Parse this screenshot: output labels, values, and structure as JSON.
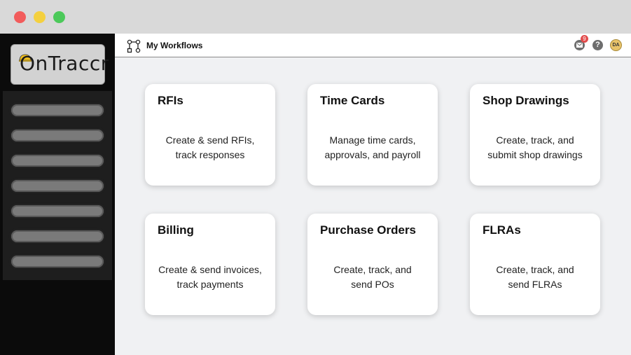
{
  "window": {
    "controls": [
      "close",
      "minimize",
      "maximize"
    ]
  },
  "sidebar": {
    "logo_text": "OnTraccr",
    "nav_item_count": 7
  },
  "header": {
    "title": "My Workflows",
    "notifications_badge": "9",
    "help_label": "?",
    "avatar_initials": "DA"
  },
  "cards": [
    {
      "title": "RFIs",
      "description": "Create & send RFIs,\ntrack responses"
    },
    {
      "title": "Time Cards",
      "description": "Manage time cards,\napprovals, and payroll"
    },
    {
      "title": "Shop Drawings",
      "description": "Create, track, and\nsubmit shop drawings"
    },
    {
      "title": "Billing",
      "description": "Create & send invoices,\ntrack payments"
    },
    {
      "title": "Purchase Orders",
      "description": "Create, track, and\nsend POs"
    },
    {
      "title": "FLRAs",
      "description": "Create, track, and\nsend FLRAs"
    }
  ],
  "colors": {
    "sidebar_bg": "#0b0b0b",
    "main_bg": "#f0f1f3",
    "badge": "#e24c4c",
    "avatar": "#e8c36a"
  }
}
